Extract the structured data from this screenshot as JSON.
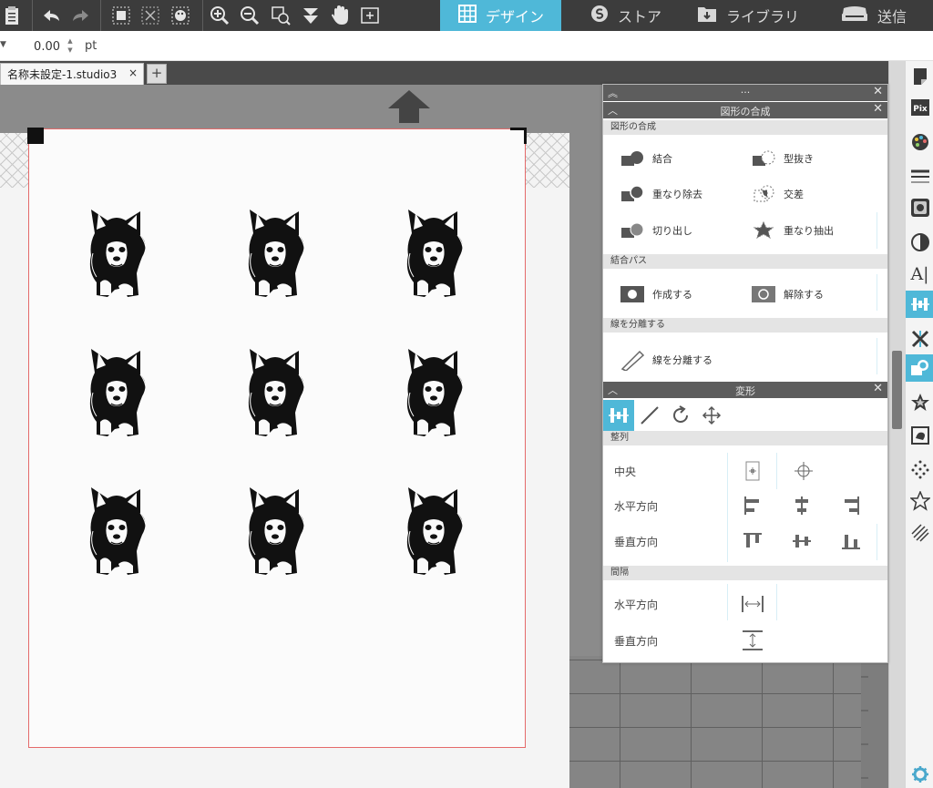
{
  "top_tabs": [
    {
      "label": "デザイン"
    },
    {
      "label": "ストア"
    },
    {
      "label": "ライブラリ"
    },
    {
      "label": "送信"
    }
  ],
  "line_style": {
    "width_value": "0.00",
    "unit": "pt"
  },
  "document_tab": {
    "name": "名称未設定-1.studio3",
    "close": "×",
    "add": "+"
  },
  "modify_panel": {
    "grip": "···",
    "title": "図形の合成",
    "section_compound": "図形の合成",
    "ops": [
      "結合",
      "型抜き",
      "重なり除去",
      "交差",
      "切り出し",
      "重なり抽出"
    ],
    "section_path": "結合パス",
    "path_ops": [
      "作成する",
      "解除する"
    ],
    "section_split": "線を分離する",
    "split_label": "線を分離する"
  },
  "transform_panel": {
    "title": "変形",
    "section_align": "整列",
    "center_label": "中央",
    "horizontal_label": "水平方向",
    "vertical_label": "垂直方向",
    "section_space": "間隔",
    "space_horizontal_label": "水平方向",
    "space_vertical_label": "垂直方向"
  },
  "text_tool_glyph": "A|",
  "colors": {
    "accent": "#4fb8d8",
    "cut_line": "#e46a6a",
    "toolbar": "#3c3c3c"
  }
}
